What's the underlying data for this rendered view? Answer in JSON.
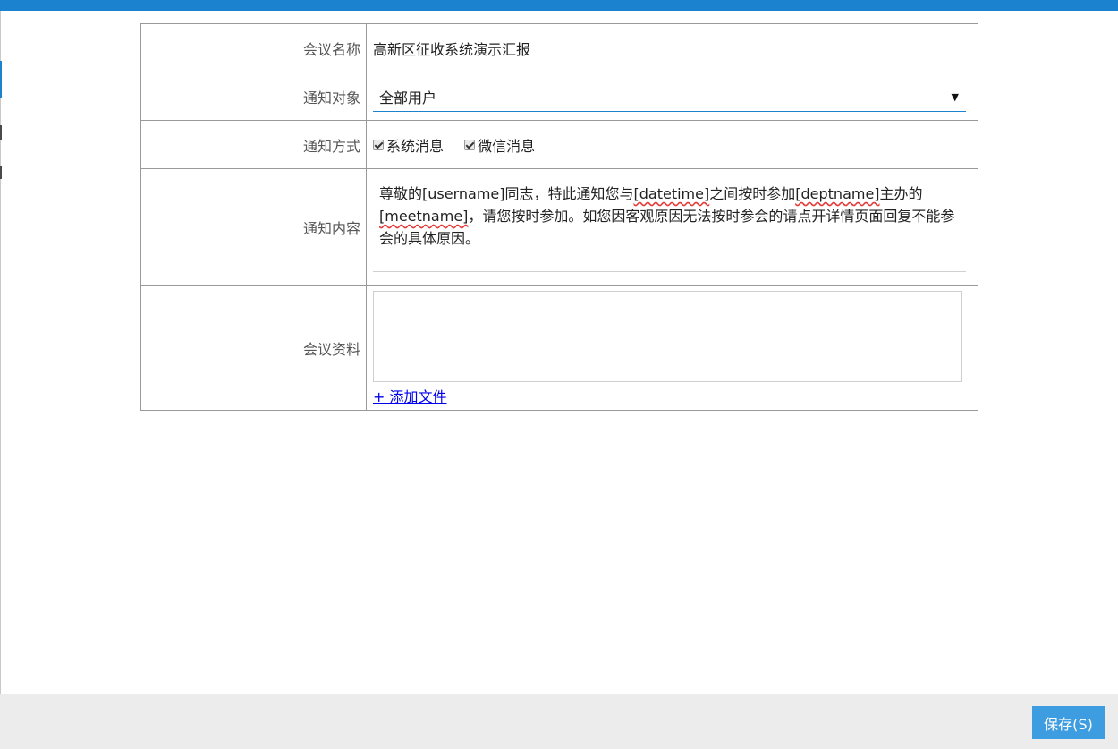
{
  "form": {
    "meeting_name": {
      "label": "会议名称",
      "value": "高新区征收系统演示汇报"
    },
    "notify_target": {
      "label": "通知对象",
      "selected": "全部用户"
    },
    "notify_method": {
      "label": "通知方式",
      "options": [
        {
          "label": "系统消息",
          "checked": true
        },
        {
          "label": "微信消息",
          "checked": true
        }
      ]
    },
    "notify_content": {
      "label": "通知内容",
      "parts": [
        "尊敬的",
        "[username]",
        "同志，特此通知您与",
        "[datetime]",
        "之间按时参加",
        "[deptname]",
        "主办的",
        "[meetname]",
        "，请您按时参加。如您因客观原因无法按时参会的请点开详情页面回复不能参会的具体原因。"
      ]
    },
    "meeting_files": {
      "label": "会议资料",
      "add_link": "+ 添加文件"
    }
  },
  "footer": {
    "save_label": "保存(S)"
  },
  "colors": {
    "topbar": "#1b82cf",
    "save_button": "#3e9de0",
    "footer_bg": "#ececec"
  },
  "icons": {
    "select_arrow": "caret-down-icon",
    "checkbox": "checkmark-icon"
  }
}
